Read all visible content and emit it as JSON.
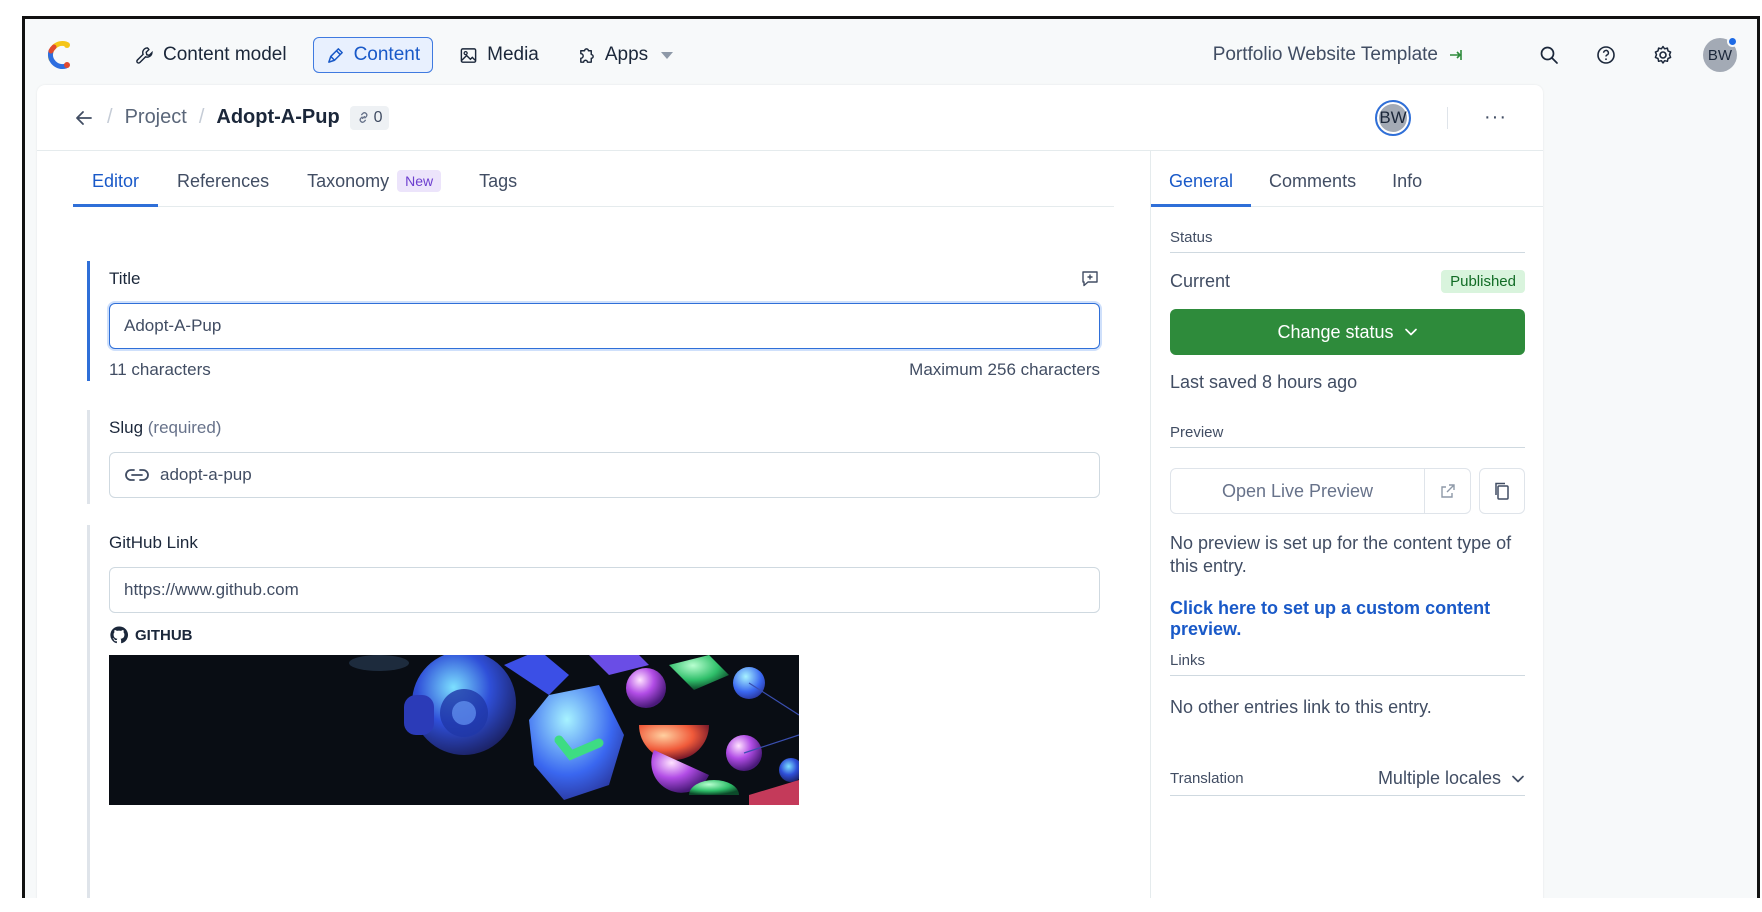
{
  "nav": {
    "items": [
      {
        "label": "Content model",
        "icon": "wrench-icon"
      },
      {
        "label": "Content",
        "icon": "pen-icon",
        "active": true
      },
      {
        "label": "Media",
        "icon": "image-icon"
      },
      {
        "label": "Apps",
        "icon": "puzzle-icon"
      }
    ],
    "space_name": "Portfolio Website Template",
    "user_initials": "BW"
  },
  "breadcrumb": {
    "parent": "Project",
    "title": "Adopt-A-Pup",
    "ref_count": "0",
    "avatar_initials": "BW",
    "more": "···"
  },
  "editor_tabs": [
    {
      "label": "Editor",
      "active": true
    },
    {
      "label": "References"
    },
    {
      "label": "Taxonomy",
      "badge": "New"
    },
    {
      "label": "Tags"
    }
  ],
  "fields": {
    "title": {
      "label": "Title",
      "value": "Adopt-A-Pup",
      "count": "11 characters",
      "max": "Maximum 256 characters"
    },
    "slug": {
      "label": "Slug",
      "required": "(required)",
      "value": "adopt-a-pup"
    },
    "github": {
      "label": "GitHub Link",
      "value": "https://www.github.com",
      "preview_source": "GITHUB"
    }
  },
  "sidebar": {
    "tabs": [
      {
        "label": "General",
        "active": true
      },
      {
        "label": "Comments"
      },
      {
        "label": "Info"
      }
    ],
    "status_title": "Status",
    "status_current": "Current",
    "status_badge": "Published",
    "change_status": "Change status",
    "last_saved": "Last saved 8 hours ago",
    "preview_title": "Preview",
    "open_live_preview": "Open Live Preview",
    "preview_note": "No preview is set up for the content type of this entry.",
    "preview_link": "Click here to set up a custom content preview.",
    "links_title": "Links",
    "links_note": "No other entries link to this entry.",
    "translation_title": "Translation",
    "translation_value": "Multiple locales"
  },
  "colors": {
    "accent": "#2f6fd8",
    "published_bg": "#d9f4dd",
    "green_button": "#2e8b3b"
  }
}
